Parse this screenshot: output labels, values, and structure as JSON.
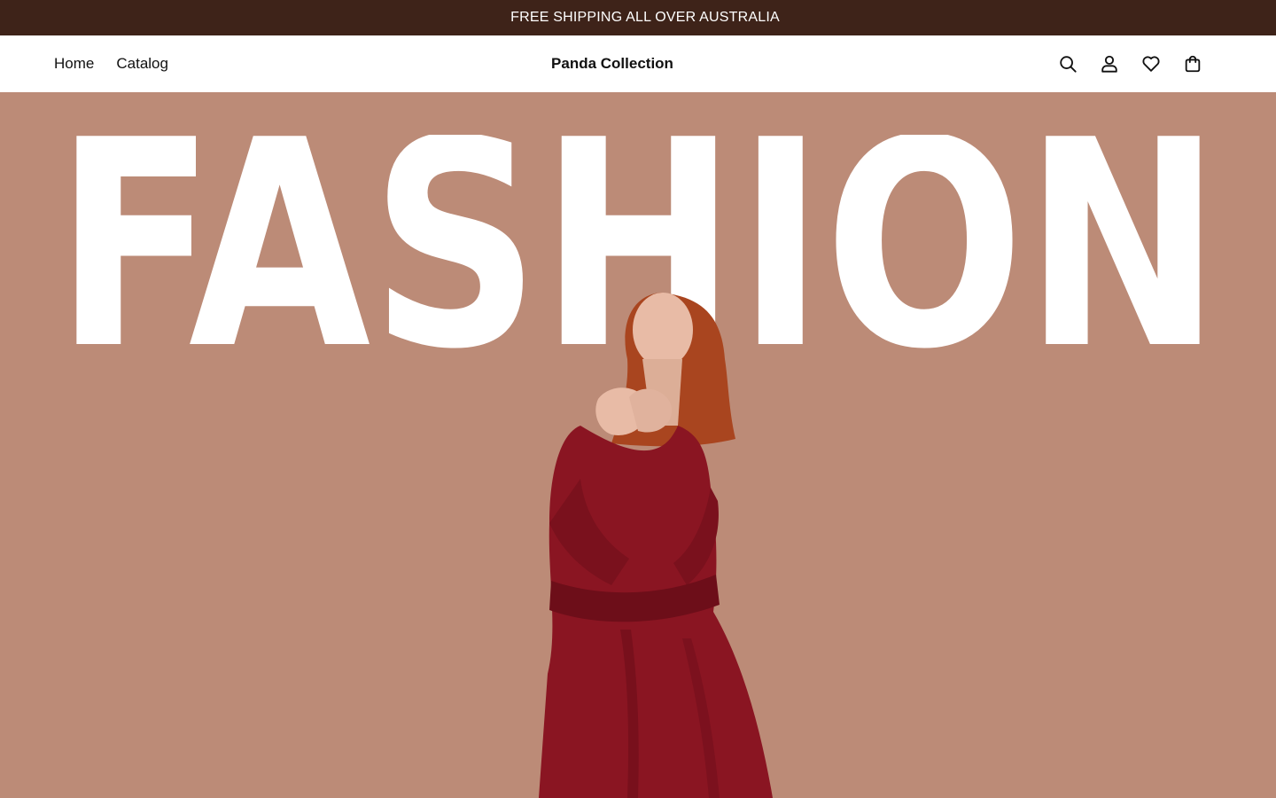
{
  "announcement": {
    "text": "FREE SHIPPING ALL OVER AUSTRALIA"
  },
  "header": {
    "nav": [
      {
        "label": "Home"
      },
      {
        "label": "Catalog"
      }
    ],
    "brand": "Panda Collection",
    "icons": [
      "search-icon",
      "account-icon",
      "wishlist-icon",
      "cart-icon"
    ]
  },
  "hero": {
    "headline": "FASHION",
    "background_color": "#bc8b77",
    "image": "woman-in-red-dress"
  },
  "colors": {
    "announcement_bg": "#3e2319",
    "hero_bg": "#bc8b77",
    "dress": "#8a1522",
    "hair": "#a9451f"
  }
}
